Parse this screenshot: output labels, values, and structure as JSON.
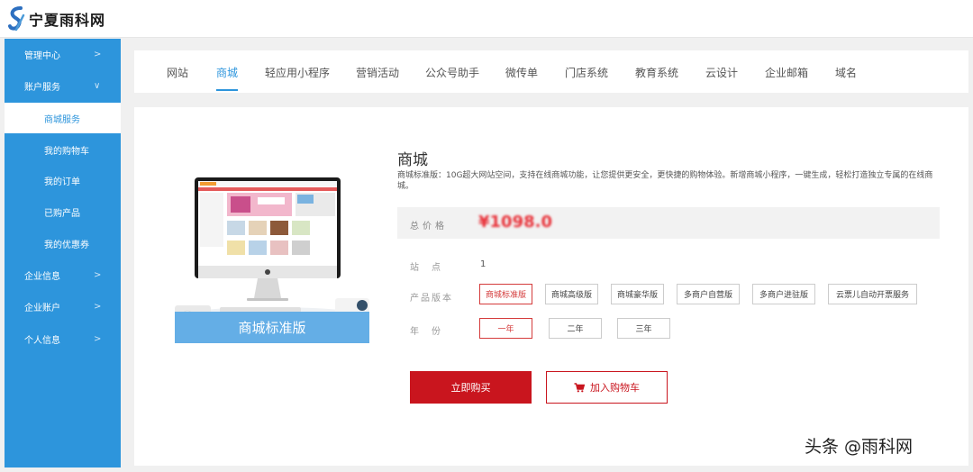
{
  "header": {
    "logo_text": "宁夏雨科网"
  },
  "sidebar": {
    "items": [
      {
        "label": "管理中心",
        "chevron": ">"
      },
      {
        "label": "账户服务",
        "chevron": "∨"
      },
      {
        "label": "企业信息",
        "chevron": ">"
      },
      {
        "label": "企业账户",
        "chevron": ">"
      },
      {
        "label": "个人信息",
        "chevron": ">"
      }
    ],
    "sub_items": [
      {
        "label": "商城服务"
      },
      {
        "label": "我的购物车"
      },
      {
        "label": "我的订单"
      },
      {
        "label": "已购产品"
      },
      {
        "label": "我的优惠券"
      }
    ]
  },
  "tabs": [
    "网站",
    "商城",
    "轻应用小程序",
    "营销活动",
    "公众号助手",
    "微传单",
    "门店系统",
    "教育系统",
    "云设计",
    "企业邮箱",
    "域名"
  ],
  "active_tab": "商城",
  "product": {
    "caption": "商城标准版",
    "title": "商城",
    "description": "商城标准版：10G超大网站空间，支持在线商城功能，让您提供更安全，更快捷的购物体验。新增商城小程序，一键生成，轻松打造独立专属的在线商城。",
    "price_label": "总价格",
    "price_value": "¥1098.0",
    "sites_label": "站　点",
    "sites_value": "1",
    "version_label": "产品版本",
    "versions": [
      "商城标准版",
      "商城高级版",
      "商城豪华版",
      "多商户自营版",
      "多商户进驻版",
      "云票儿自动开票服务"
    ],
    "selected_version": "商城标准版",
    "years_label": "年　份",
    "years": [
      "一年",
      "二年",
      "三年"
    ],
    "selected_year": "一年",
    "buy_label": "立即购买",
    "cart_label": "加入购物车"
  },
  "watermark": "头条 @雨科网",
  "colors": {
    "primary": "#2d95dc",
    "accent": "#c9151e",
    "price": "#e8323a"
  }
}
